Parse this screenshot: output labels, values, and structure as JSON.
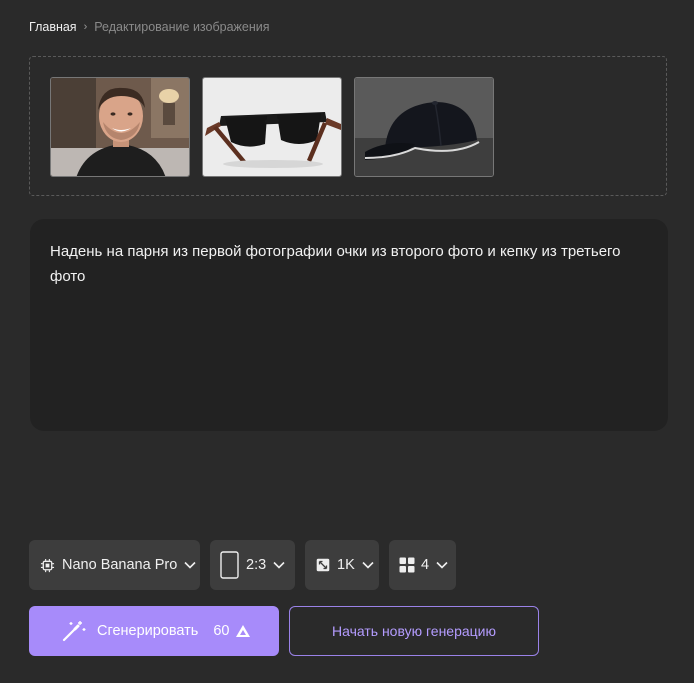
{
  "breadcrumb": {
    "home": "Главная",
    "separator": "›",
    "current": "Редактирование изображения"
  },
  "uploads": [
    {
      "icon": "portrait-photo"
    },
    {
      "icon": "sunglasses-photo"
    },
    {
      "icon": "cap-photo"
    }
  ],
  "prompt": {
    "text": "Надень на парня из первой фотографии очки из второго фото и кепку из третьего фото"
  },
  "controls": {
    "model": {
      "label": "Nano Banana Pro",
      "icon": "chip-icon"
    },
    "aspect": {
      "label": "2:3",
      "icon": "portrait-frame-icon"
    },
    "resolution": {
      "label": "1K",
      "icon": "resize-icon"
    },
    "count": {
      "label": "4",
      "icon": "grid-icon"
    }
  },
  "actions": {
    "generate_label": "Сгенерировать",
    "generate_cost": "60",
    "new_generation_label": "Начать новую генерацию"
  },
  "colors": {
    "accent": "#a78bfa",
    "background": "#2a2a2a",
    "panel": "#222222",
    "control": "#3d3d3d"
  }
}
